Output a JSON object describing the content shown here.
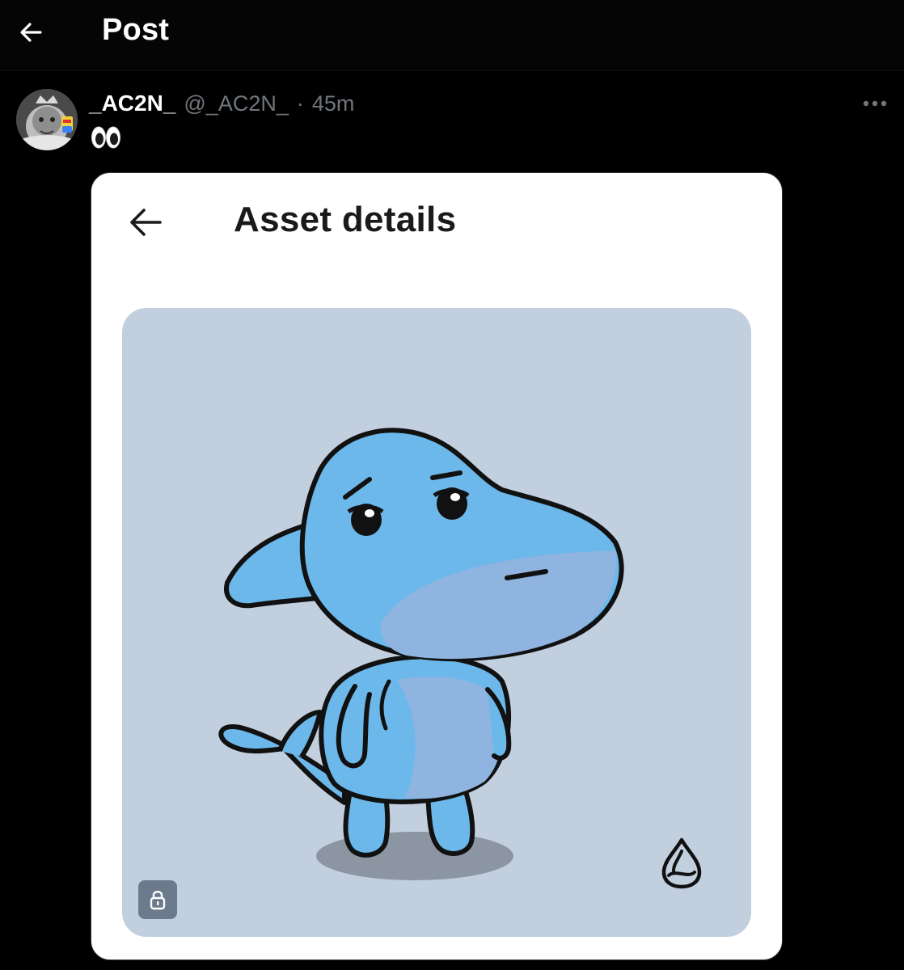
{
  "header": {
    "title": "Post",
    "back_icon": "arrow-left-icon"
  },
  "post": {
    "author": {
      "display_name": "_AC2N_",
      "handle": "@_AC2N_",
      "separator": "·",
      "time": "45m",
      "avatar_icon": "avatar-image"
    },
    "text": "👀",
    "more_icon": "more-horizontal-icon"
  },
  "embedded_screen": {
    "title": "Asset details",
    "back_icon": "arrow-left-icon",
    "lock_icon": "lock-icon",
    "brand_icon": "sui-drop-icon"
  },
  "colors": {
    "background": "#000000",
    "card": "#ffffff",
    "asset_bg": "#c2cfdf",
    "character_blue": "#6cb8ea",
    "character_shade": "#8fb4df",
    "muted_text": "#71767b"
  }
}
